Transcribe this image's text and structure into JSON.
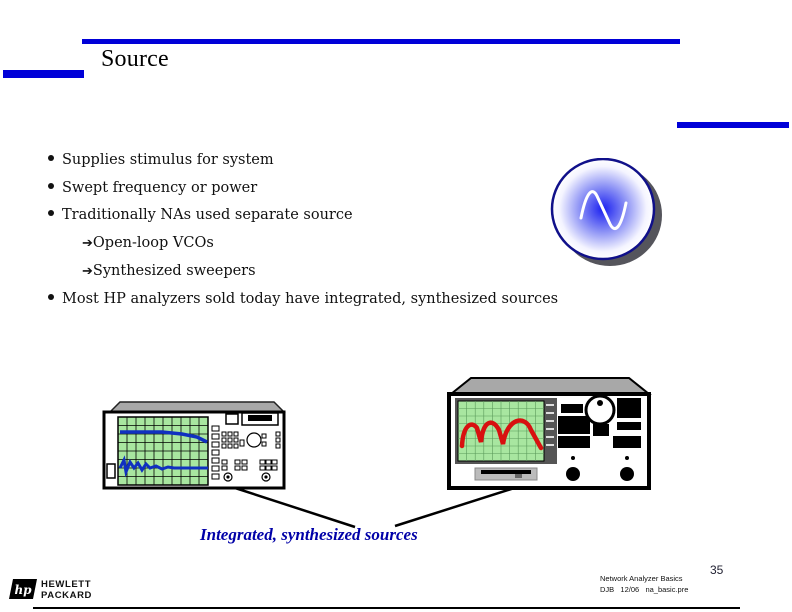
{
  "slide": {
    "title": "Source",
    "page_number": "35",
    "accent_color": "#0000d8"
  },
  "bullets": [
    {
      "level": 1,
      "text": "Supplies stimulus for system"
    },
    {
      "level": 1,
      "text": "Swept frequency or power"
    },
    {
      "level": 1,
      "text": "Traditionally NAs used separate source"
    },
    {
      "level": 2,
      "marker": "➔",
      "text": "Open-loop VCOs"
    },
    {
      "level": 2,
      "marker": "➔",
      "text": "Synthesized sweepers"
    },
    {
      "level": 1,
      "text": "Most HP analyzers sold today have integrated, synthesized sources"
    }
  ],
  "illustration": {
    "source_icon": "sine-wave-source-icon",
    "caption": "Integrated, synthesized sources",
    "caption_color": "#0000a8",
    "left_instrument_trace_color": "#1030c0",
    "right_instrument_trace_color": "#d81010",
    "screen_color": "#a8e6a0"
  },
  "footer": {
    "company_line1": "HEWLETT",
    "company_line2": "PACKARD",
    "logo_text": "hp",
    "course_title": "Network Analyzer Basics",
    "course_info": "DJB   12/06   na_basic.pre"
  }
}
